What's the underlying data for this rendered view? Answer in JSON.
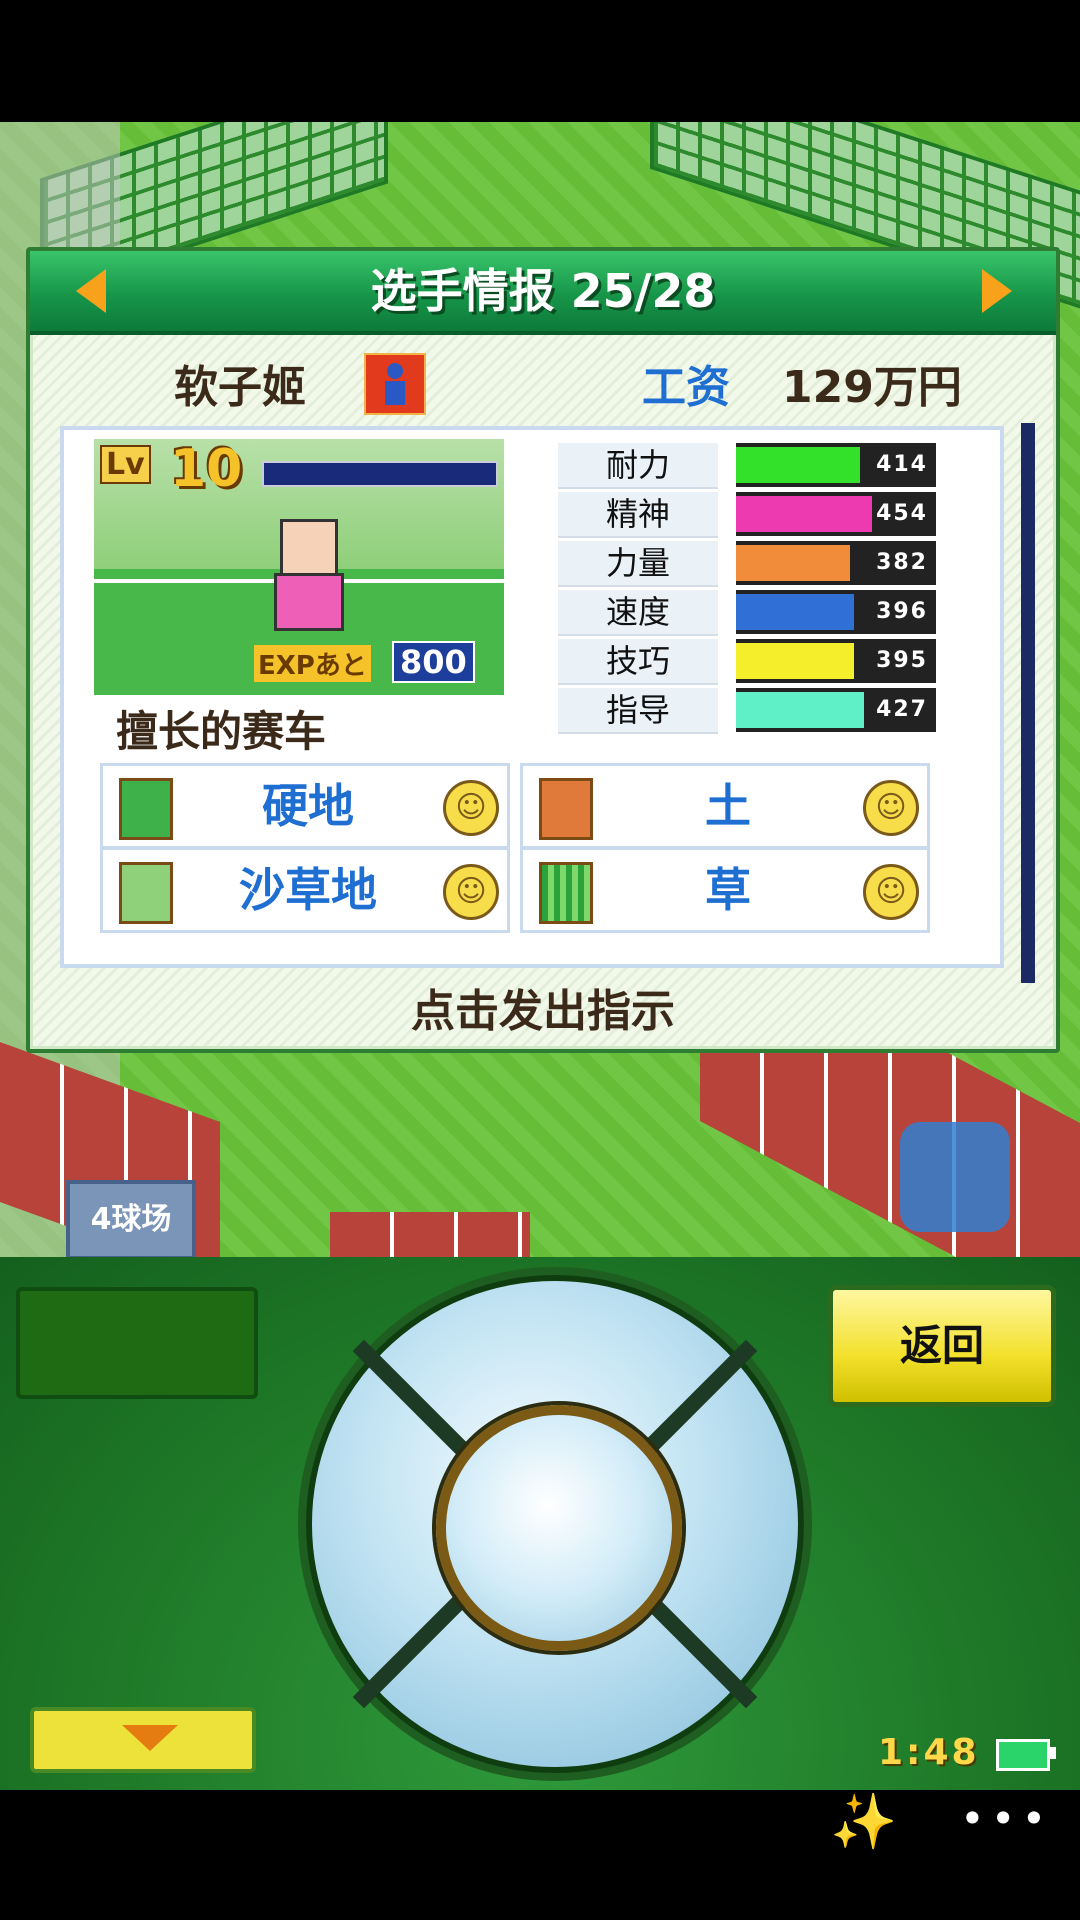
{
  "panel": {
    "title": "选手情报 25/28",
    "player_name": "软子姬",
    "salary_label": "工资",
    "salary_value": "129万円",
    "level_label": "Lv",
    "level_value": "10",
    "exp_label": "EXPあと",
    "exp_value": "800",
    "stats": [
      {
        "label": "耐力",
        "value": "414",
        "color": "#33e02a",
        "fill": 0.62
      },
      {
        "label": "精神",
        "value": "454",
        "color": "#ee3ab0",
        "fill": 0.68
      },
      {
        "label": "力量",
        "value": "382",
        "color": "#f08c3a",
        "fill": 0.57
      },
      {
        "label": "速度",
        "value": "396",
        "color": "#2f6fd6",
        "fill": 0.59
      },
      {
        "label": "技巧",
        "value": "395",
        "color": "#f5ee2a",
        "fill": 0.59
      },
      {
        "label": "指导",
        "value": "427",
        "color": "#5ff0c8",
        "fill": 0.64
      }
    ],
    "specialty_title": "擅长的赛车",
    "courts": [
      {
        "name": "硬地",
        "icon": "hard-court-icon",
        "face": "☺"
      },
      {
        "name": "土",
        "icon": "clay-court-icon",
        "face": "☺"
      },
      {
        "name": "沙草地",
        "icon": "sand-grass-court-icon",
        "face": "☺"
      },
      {
        "name": "草",
        "icon": "grass-court-icon",
        "face": "☺"
      }
    ],
    "hint": "点击发出指示"
  },
  "field": {
    "court_badge": "4球场"
  },
  "controller": {
    "back_label": "返回",
    "time": "1:48"
  }
}
